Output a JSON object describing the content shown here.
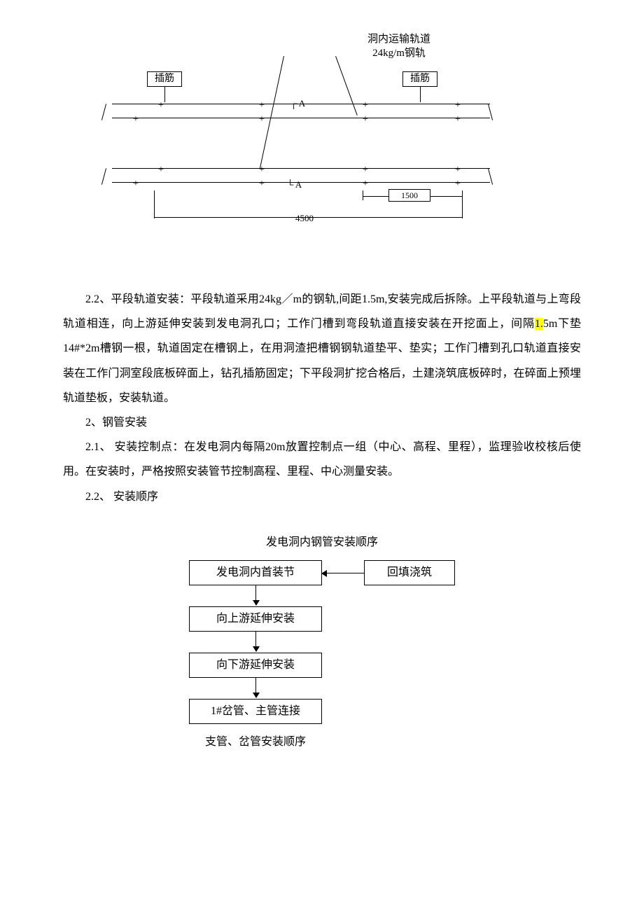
{
  "diagram_top": {
    "title_line1": "洞内运输轨道",
    "title_line2": "24kg/m钢轨",
    "label_left": "插筋",
    "label_right": "插筋",
    "section_mark_a1": "A",
    "section_mark_a2": "A",
    "dim_inner": "1500",
    "dim_outer": "4500"
  },
  "body": {
    "p1_prefix": "2.2、平段轨道安装：平段轨道采用24kg／m的钢轨,间距1.5m,安装完成后拆除。上平段轨道与上弯段轨道相连，向上游延伸安装到发电洞孔口；工作门槽到弯段轨道直接安装在开挖面上，间隔",
    "p1_hl": "1.",
    "p1_suffix": "5m下垫14#*2m槽钢一根，轨道固定在槽钢上，在用洞渣把槽钢钢轨道垫平、垫实；工作门槽到孔口轨道直接安装在工作门洞室段底板碎面上，钻孔插筋固定；下平段洞扩挖合格后，土建浇筑底板碎时，在碎面上预埋轨道垫板，安装轨道。",
    "p2": "2、钢管安装",
    "p3": "2.1、 安装控制点：在发电洞内每隔20m放置控制点一组（中心、高程、里程），监理验收校核后使用。在安装时，严格按照安装管节控制高程、里程、中心测量安装。",
    "p4": "2.2、    安装顺序"
  },
  "flow": {
    "title": "发电洞内钢管安装顺序",
    "b1": "发电洞内首装节",
    "b1r": "回填浇筑",
    "b2": "向上游延伸安装",
    "b3": "向下游延伸安装",
    "b4": "1#岔管、主管连接",
    "subtitle": "支管、岔管安装顺序"
  }
}
